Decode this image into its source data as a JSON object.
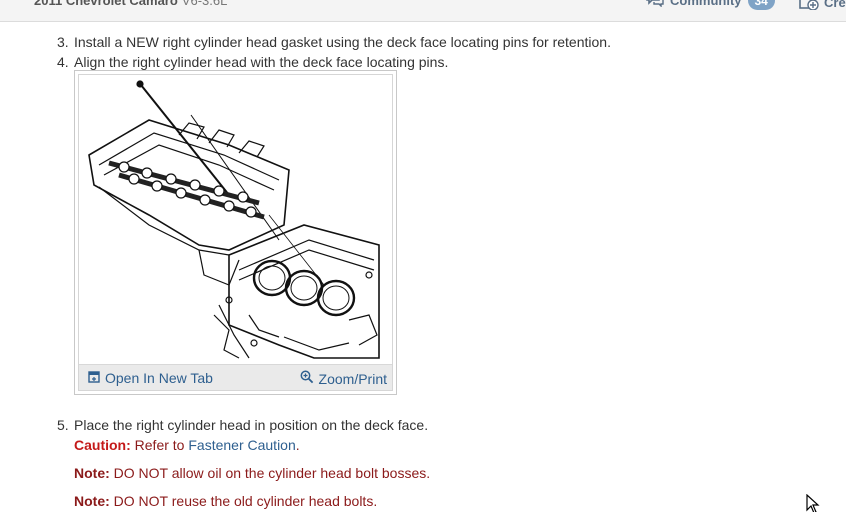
{
  "header": {
    "vehicle": "2011 Chevrolet Camaro",
    "engine": "V6-3.6L",
    "community_label": "Community",
    "community_count": "34",
    "create_label": "Cre"
  },
  "steps": {
    "step3": {
      "number": "3.",
      "text": "Install a NEW right cylinder head gasket using the deck face locating pins for retention."
    },
    "step4": {
      "number": "4.",
      "text": "Align the right cylinder head with the deck face locating pins."
    },
    "step5": {
      "number": "5.",
      "text": "Place the right cylinder head in position on the deck face."
    }
  },
  "figure": {
    "open_tab_label": "Open In New Tab",
    "zoom_print_label": "Zoom/Print"
  },
  "notes": {
    "caution_label": "Caution:",
    "caution_text": "Refer to",
    "caution_link": "Fastener Caution",
    "caution_end": ".",
    "note1_label": "Note:",
    "note1_text": "DO NOT allow oil on the cylinder head bolt bosses.",
    "note2_label": "Note:",
    "note2_text": "DO NOT reuse the old cylinder head bolts."
  },
  "colors": {
    "link": "#2e5f8f",
    "caution": "#c41a1a",
    "note": "#8b1a1a",
    "badge": "#7fa3c6"
  }
}
